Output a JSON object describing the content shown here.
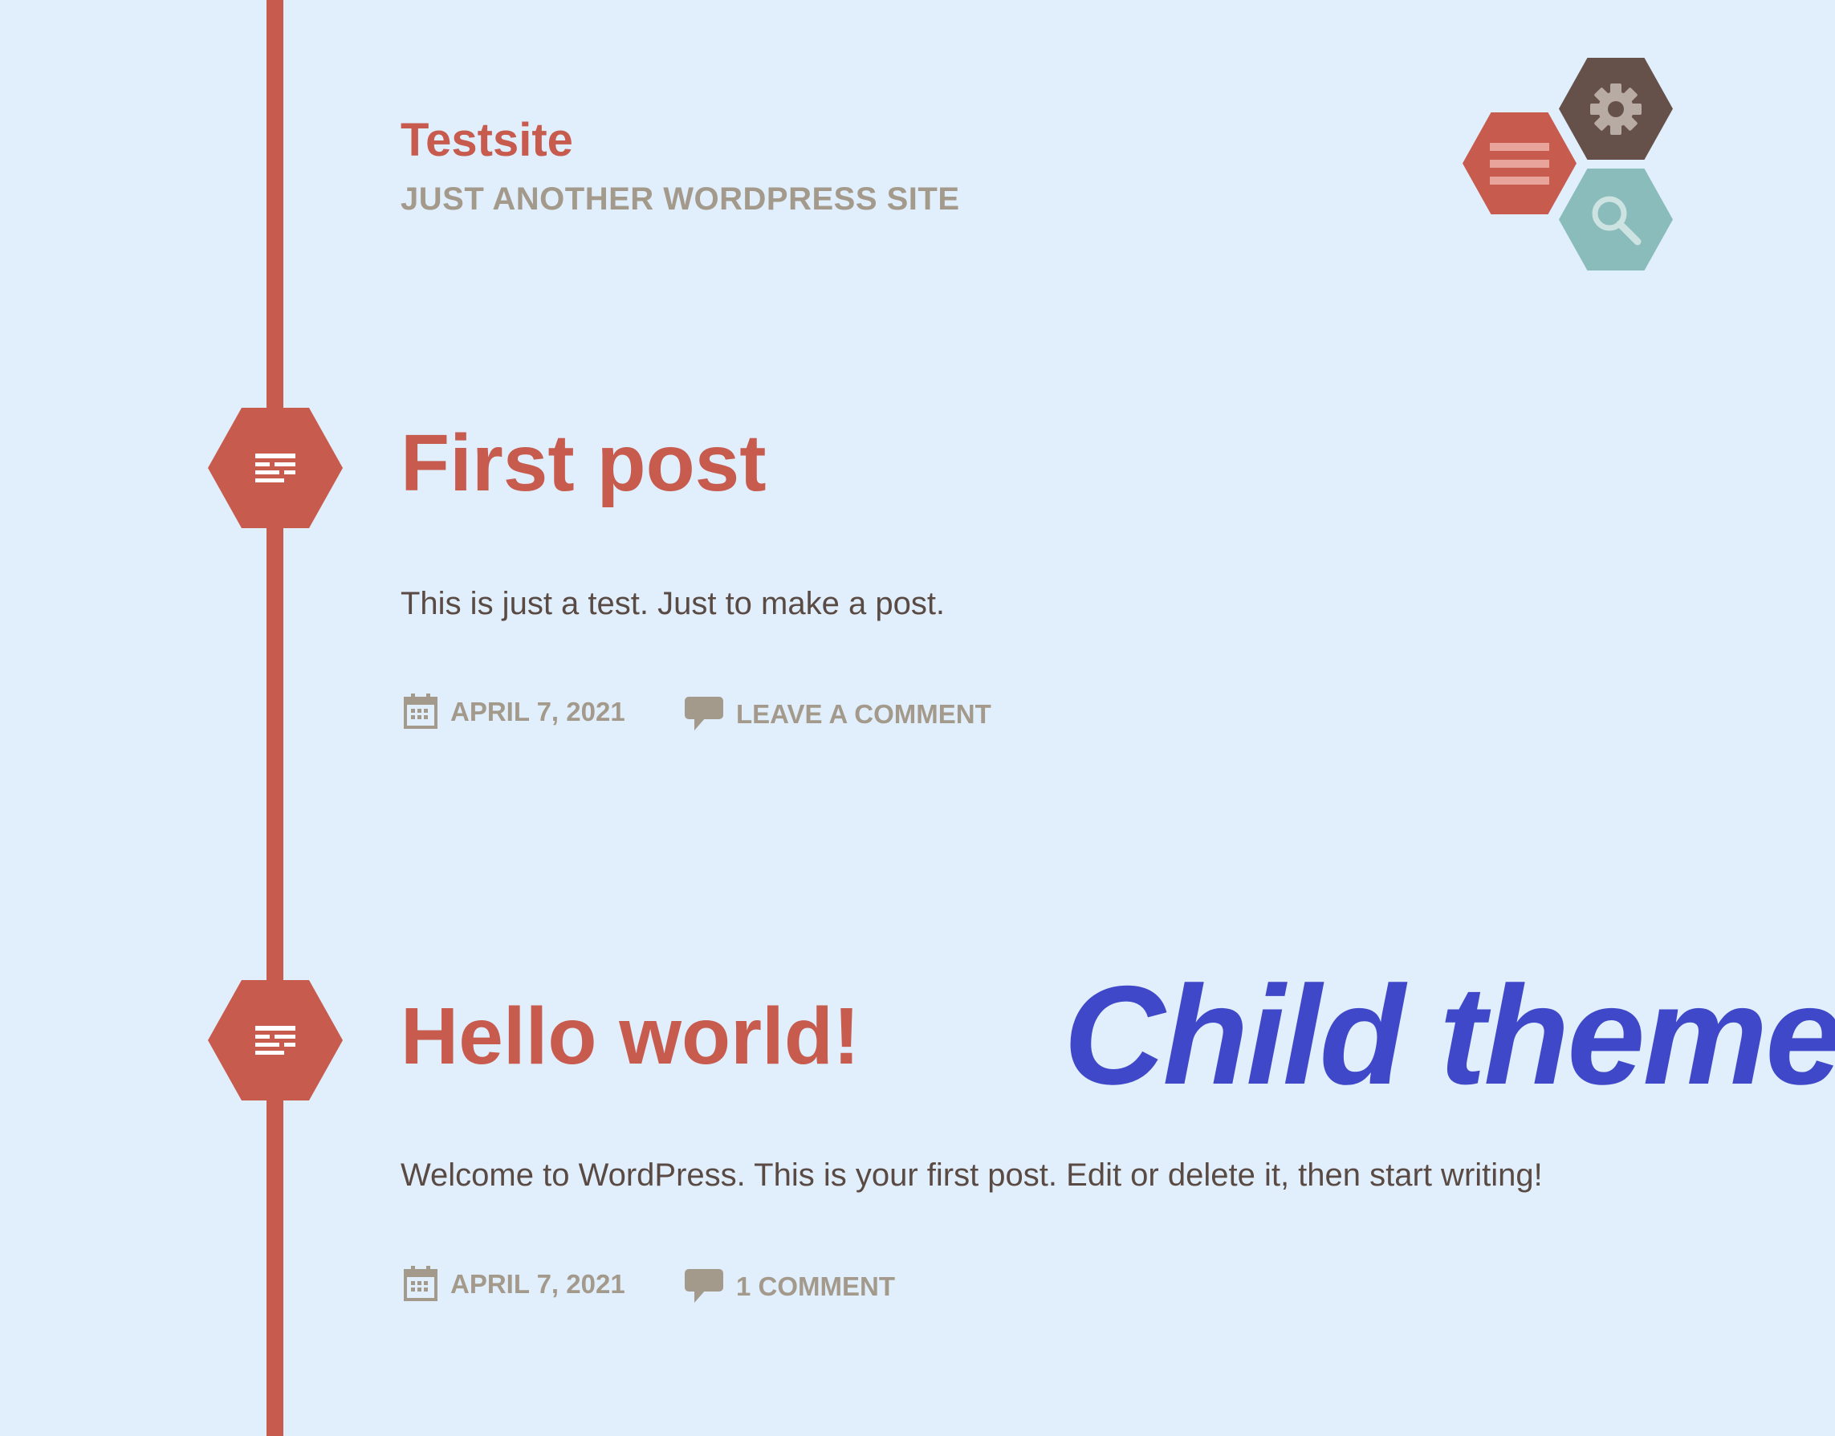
{
  "colors": {
    "background": "#e1eefc",
    "accent": "#c75b4e",
    "meta": "#a39a8c",
    "text": "#5a4a44",
    "settings": "#66514a",
    "search": "#89bcbb",
    "child_theme": "#3e48c8"
  },
  "site": {
    "title": "Testsite",
    "description": "JUST ANOTHER WORDPRESS SITE"
  },
  "nav": {
    "menu_icon": "menu-icon",
    "settings_icon": "gear-icon",
    "search_icon": "search-icon"
  },
  "posts": [
    {
      "title": "First post",
      "excerpt": "This is just a test. Just to make a post.",
      "date": "APRIL 7, 2021",
      "comments": "LEAVE A COMMENT",
      "format_icon": "standard-post-icon"
    },
    {
      "title": "Hello world!",
      "excerpt": "Welcome to WordPress. This is your first post. Edit or delete it, then start writing!",
      "date": "APRIL 7, 2021",
      "comments": "1 COMMENT",
      "format_icon": "standard-post-icon"
    }
  ],
  "overlay": {
    "label": "Child theme"
  }
}
